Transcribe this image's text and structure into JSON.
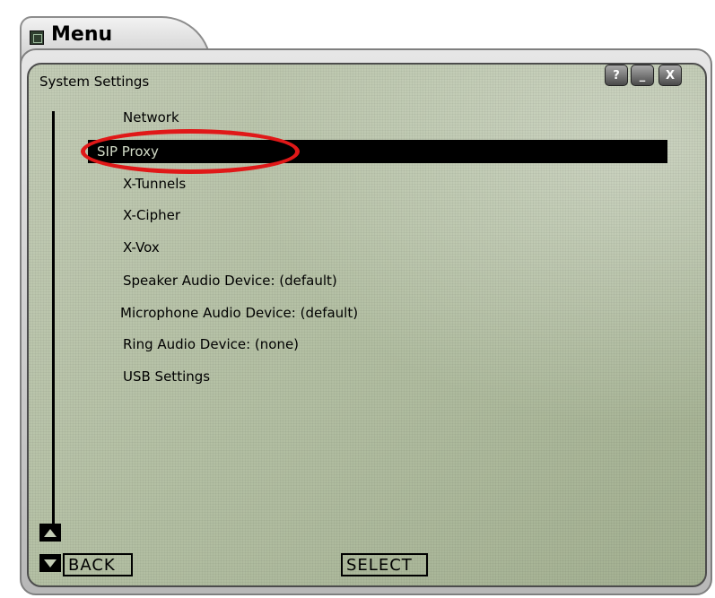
{
  "window": {
    "tab_title": "Menu",
    "panel_title": "System Settings",
    "buttons": {
      "help": "?",
      "minimize": "_",
      "close": "X"
    }
  },
  "menu": {
    "items": [
      {
        "label": "Network",
        "selected": false
      },
      {
        "label": "SIP Proxy",
        "selected": true
      },
      {
        "label": "X-Tunnels",
        "selected": false
      },
      {
        "label": "X-Cipher",
        "selected": false
      },
      {
        "label": "X-Vox",
        "selected": false
      },
      {
        "label": "Speaker Audio Device: (default)",
        "selected": false
      },
      {
        "label": "Microphone Audio Device: (default)",
        "selected": false
      },
      {
        "label": "Ring Audio Device: (none)",
        "selected": false
      },
      {
        "label": "USB Settings",
        "selected": false
      }
    ]
  },
  "softkeys": {
    "back": "BACK",
    "select": "SELECT"
  },
  "colors": {
    "lcd_bg": "#b4c0a4",
    "selection_bg": "#000000",
    "annotation": "#e01818"
  }
}
